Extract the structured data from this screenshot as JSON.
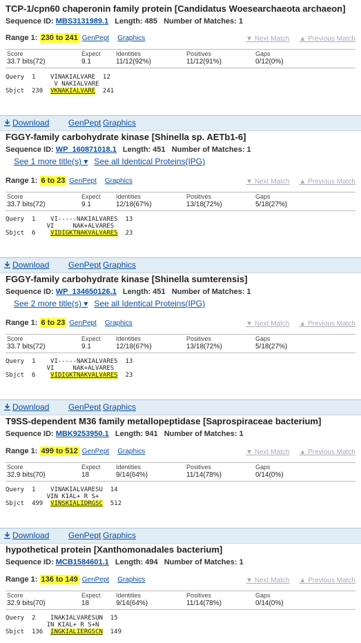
{
  "toolbar": {
    "download": "Download",
    "genpept": "GenPept",
    "graphics": "Graphics"
  },
  "labels": {
    "seq_id": "Sequence ID:",
    "length": "Length:",
    "matches": "Number of Matches:",
    "range": "Range 1:",
    "genpept": "GenPept",
    "graphics": "Graphics",
    "next": "▼ Next Match",
    "prev": "▲ Previous Match",
    "score": "Score",
    "expect": "Expect",
    "identities": "Identities",
    "positives": "Positives",
    "gaps": "Gaps",
    "identical": "See all Identical Proteins(IPG)"
  },
  "hits": [
    {
      "title": "TCP-1/cpn60 chaperonin family protein [Candidatus Woesearchaeota archaeon]",
      "seq_id": "MBS3131989.1",
      "length": "485",
      "matches": "1",
      "range": "230 to 241",
      "score": "33.7 bits(72)",
      "expect": "9.1",
      "identities": "11/12(92%)",
      "positives": "11/12(91%)",
      "gaps": "0/12(0%)",
      "q_label": "Query",
      "q_start": "1",
      "q_seq": "VINAKIALVARE",
      "q_end": "12",
      "mid": "V NAKIALVARE",
      "s_label": "Sbjct",
      "s_start": "230",
      "s_seq": "VKNAKIALVARE",
      "s_end": "241"
    },
    {
      "title": "FGGY-family carbohydrate kinase [Shinella sp. AETb1-6]",
      "seq_id": "WP_160871018.1",
      "length": "451",
      "matches": "1",
      "more": "See 1 more title(s) ▾",
      "range": "6 to 23",
      "score": "33.7 bits(72)",
      "expect": "9.1",
      "identities": "12/18(67%)",
      "positives": "13/18(72%)",
      "gaps": "5/18(27%)",
      "q_label": "Query",
      "q_start": "1",
      "q_seq": "VI-----NAKIALVARES",
      "q_end": "13",
      "mid": "VI     NAK+ALVARES",
      "s_label": "Sbjct",
      "s_start": "6",
      "s_seq": "VIDIGKTNAKVALVARES",
      "s_end": "23"
    },
    {
      "title": "FGGY-family carbohydrate kinase [Shinella sumterensis]",
      "seq_id": "WP_134650126.1",
      "length": "451",
      "matches": "1",
      "more": "See 2 more title(s) ▾",
      "range": "6 to 23",
      "score": "33.7 bits(72)",
      "expect": "9.1",
      "identities": "12/18(67%)",
      "positives": "13/18(72%)",
      "gaps": "5/18(27%)",
      "q_label": "Query",
      "q_start": "1",
      "q_seq": "VI-----NAKIALVARES",
      "q_end": "13",
      "mid": "VI     NAK+ALVARES",
      "s_label": "Sbjct",
      "s_start": "6",
      "s_seq": "VIDIGKTNAKVALVARES",
      "s_end": "23"
    },
    {
      "title": "T9SS-dependent M36 family metallopeptidase [Saprospiraceae bacterium]",
      "seq_id": "MBK9253950.1",
      "length": "941",
      "matches": "1",
      "range": "499 to 512",
      "score": "32.9 bits(70)",
      "expect": "18",
      "identities": "9/14(64%)",
      "positives": "11/14(78%)",
      "gaps": "0/14(0%)",
      "q_label": "Query",
      "q_start": "1",
      "q_seq": "VINAKIALVARESU",
      "q_end": "14",
      "mid": "VIN KIAL+ R S+",
      "s_label": "Sbjct",
      "s_start": "499",
      "s_seq": "VINSKIALIDRGSC",
      "s_end": "512"
    },
    {
      "title": "hypothetical protein [Xanthomonadales bacterium]",
      "seq_id": "MCB1584601.1",
      "length": "494",
      "matches": "1",
      "range": "136 to 149",
      "score": "32.9 bits(70)",
      "expect": "18",
      "identities": "9/14(64%)",
      "positives": "11/14(78%)",
      "gaps": "0/14(0%)",
      "q_label": "Query",
      "q_start": "2",
      "q_seq": "INAKIALVARESUN",
      "q_end": "15",
      "mid": "IN KIAL+ R S+N",
      "s_label": "Sbjct",
      "s_start": "136",
      "s_seq": "INGKIALIERGSCN",
      "s_end": "149"
    }
  ]
}
